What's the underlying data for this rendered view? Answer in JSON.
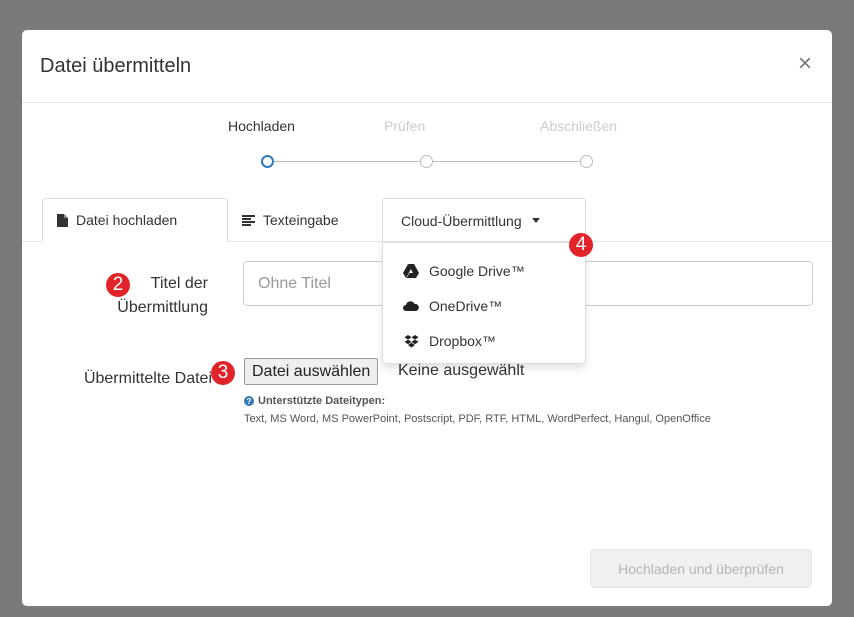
{
  "modal": {
    "title": "Datei übermitteln",
    "close_label": "×"
  },
  "steps": [
    {
      "label": "Hochladen",
      "state": "active"
    },
    {
      "label": "Prüfen",
      "state": "inactive"
    },
    {
      "label": "Abschließen",
      "state": "inactive"
    }
  ],
  "tabs": {
    "upload": {
      "label": "Datei hochladen",
      "icon": "file-icon"
    },
    "text": {
      "label": "Texteingabe",
      "icon": "align-left-icon"
    },
    "cloud": {
      "label": "Cloud-Übermittlung",
      "icon": "caret-down-icon"
    }
  },
  "cloud_menu": [
    {
      "label": "Google Drive™",
      "icon": "google-drive-icon"
    },
    {
      "label": "OneDrive™",
      "icon": "onedrive-icon"
    },
    {
      "label": "Dropbox™",
      "icon": "dropbox-icon"
    }
  ],
  "form": {
    "title_label_line1": "Titel der",
    "title_label_line2": "Übermittlung",
    "title_placeholder": "Ohne Titel",
    "file_label": "Übermittelte Datei",
    "file_button": "Datei auswählen",
    "no_file_text": "Keine ausgewählt",
    "help_title": "Unterstützte Dateitypen:",
    "help_types": "Text, MS Word, MS PowerPoint, Postscript, PDF, RTF, HTML, WordPerfect, Hangul, OpenOffice"
  },
  "badges": {
    "b2": "2",
    "b3": "3",
    "b4": "4"
  },
  "submit_label": "Hochladen und überprüfen",
  "colors": {
    "accent": "#337ab7",
    "badge": "#e0242a",
    "overlay": "#7a7a7a"
  }
}
